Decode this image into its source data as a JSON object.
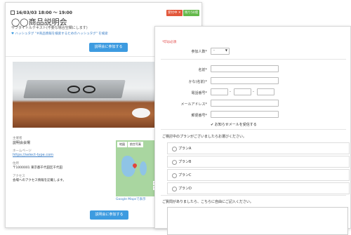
{
  "event": {
    "date": "16/03/03 18:00 ～ 19:00",
    "title": "◯◯商品説明会",
    "subtitle": "サブタイトルテキスト(不要な場合空欄にします)",
    "hashtag": "ハッシュタグ \"#商品情報を検索するためのハッシュタグ\" を検索",
    "badge_accepting": "受付中",
    "badge_remaining": "残り50席",
    "apply_label": "説明会に参加する",
    "organizer_label": "主催者",
    "organizer": "説明会会場",
    "homepage_label": "ホームページ",
    "homepage": "https://select-type.com",
    "address_label": "住所",
    "address": "〒1000001 東京都千代田区千代田",
    "access_label": "アクセス",
    "access": "会場へのアクセス情報を記載します。",
    "map_link": "Google Mapsで表示",
    "map_btn1": "地図",
    "map_btn2": "航空写真"
  },
  "form": {
    "required_note": "*印は必須",
    "participants_label": "参加人数*",
    "participants_value": "-",
    "name_label": "名前*",
    "kana_label": "かな(名前)*",
    "phone_label": "電話番号*",
    "email_label": "メールアドレス*",
    "zip_label": "郵便番号*",
    "newsletter": "お知らせメールを受信する",
    "plan_question": "ご検討中のプランがございましたらお選びください。",
    "plans": [
      "プランA",
      "プランB",
      "プランC",
      "プランD"
    ],
    "comment_question": "ご質問がありましたら、こちらに自由にご記入ください。"
  },
  "colors": {
    "accent_blue": "#3d9be0",
    "badge_red": "#e2573b",
    "badge_green": "#63b84a",
    "required_red": "#e04040"
  }
}
